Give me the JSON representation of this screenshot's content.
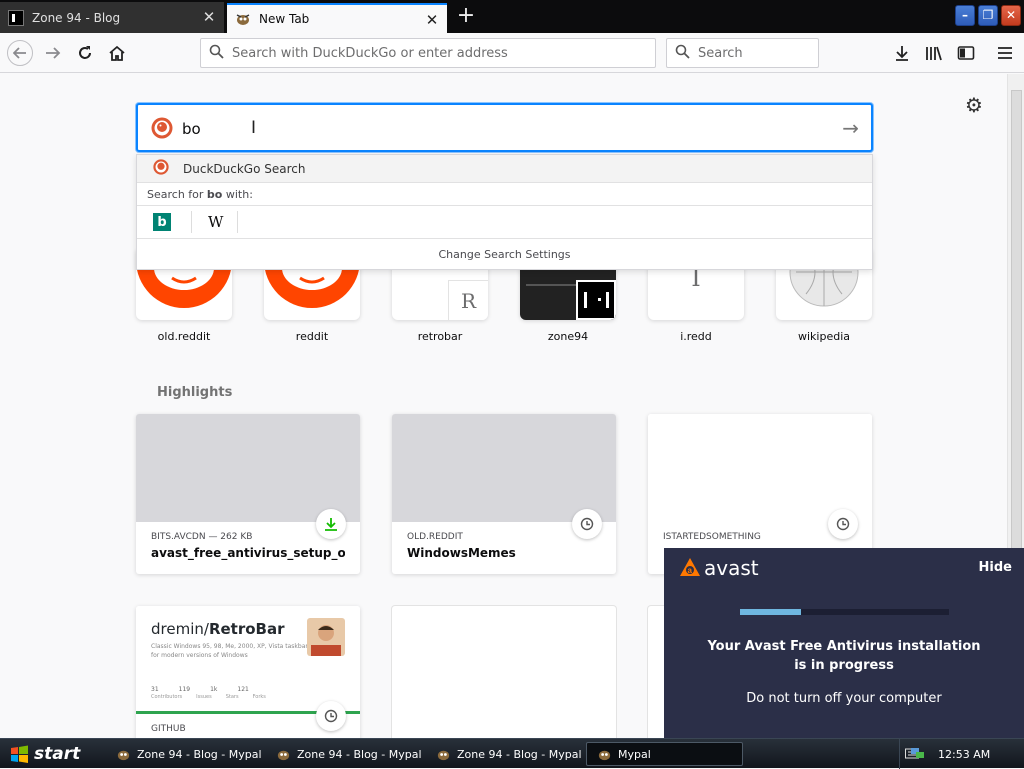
{
  "tabs": [
    {
      "title": "Zone 94 - Blog",
      "active": false
    },
    {
      "title": "New Tab",
      "active": true
    }
  ],
  "toolbar": {
    "url_placeholder": "Search with DuckDuckGo or enter address",
    "search_placeholder": "Search"
  },
  "search": {
    "typed": "bo",
    "engine_row": "DuckDuckGo Search",
    "search_for_prefix": "Search for ",
    "search_for_term": "bo",
    "search_for_suffix": " with:",
    "settings": "Change Search Settings",
    "engines": [
      "bing-icon",
      "wikipedia-icon"
    ],
    "wiki_glyph": "W"
  },
  "top_sites": [
    {
      "label": "old.reddit",
      "glyph": ""
    },
    {
      "label": "reddit",
      "glyph": ""
    },
    {
      "label": "retrobar",
      "glyph": "R"
    },
    {
      "label": "zone94",
      "glyph": ""
    },
    {
      "label": "i.redd",
      "glyph": "I"
    },
    {
      "label": "wikipedia",
      "glyph": ""
    }
  ],
  "highlights": {
    "title": "Highlights",
    "cards": [
      {
        "source": "BITS.AVCDN — 262 KB",
        "title": "avast_free_antivirus_setup_onlin..."
      },
      {
        "source": "OLD.REDDIT",
        "title": "WindowsMemes"
      },
      {
        "source": "ISTARTEDSOMETHING",
        "title": ""
      },
      {
        "source": "GITHUB",
        "title": "",
        "preview": {
          "repo_owner": "dremin/",
          "repo_name": "RetroBar",
          "desc": "Classic Windows 95, 98, Me, 2000, XP, Vista taskbar for modern versions of Windows",
          "stats": [
            "31",
            "119",
            "1k",
            "121"
          ],
          "stat_labels": [
            "Contributors",
            "Issues",
            "Stars",
            "Forks"
          ]
        }
      }
    ]
  },
  "avast": {
    "brand": "avast",
    "hide": "Hide",
    "progress": 0.29,
    "message_line1": "Your Avast Free Antivirus installation",
    "message_line2": "is in progress",
    "sub": "Do not turn off your computer"
  },
  "taskbar": {
    "start": "start",
    "tasks": [
      {
        "label": "Zone 94 - Blog - Mypal",
        "active": false
      },
      {
        "label": "Zone 94 - Blog - Mypal",
        "active": false
      },
      {
        "label": "Zone 94 - Blog - Mypal",
        "active": false
      },
      {
        "label": "Mypal",
        "active": true
      }
    ],
    "clock": "12:53 AM"
  },
  "colors": {
    "accent": "#0a84ff",
    "reddit": "#ff4500",
    "avast_bg": "#2b2f48",
    "avast_orange": "#ff7800"
  }
}
